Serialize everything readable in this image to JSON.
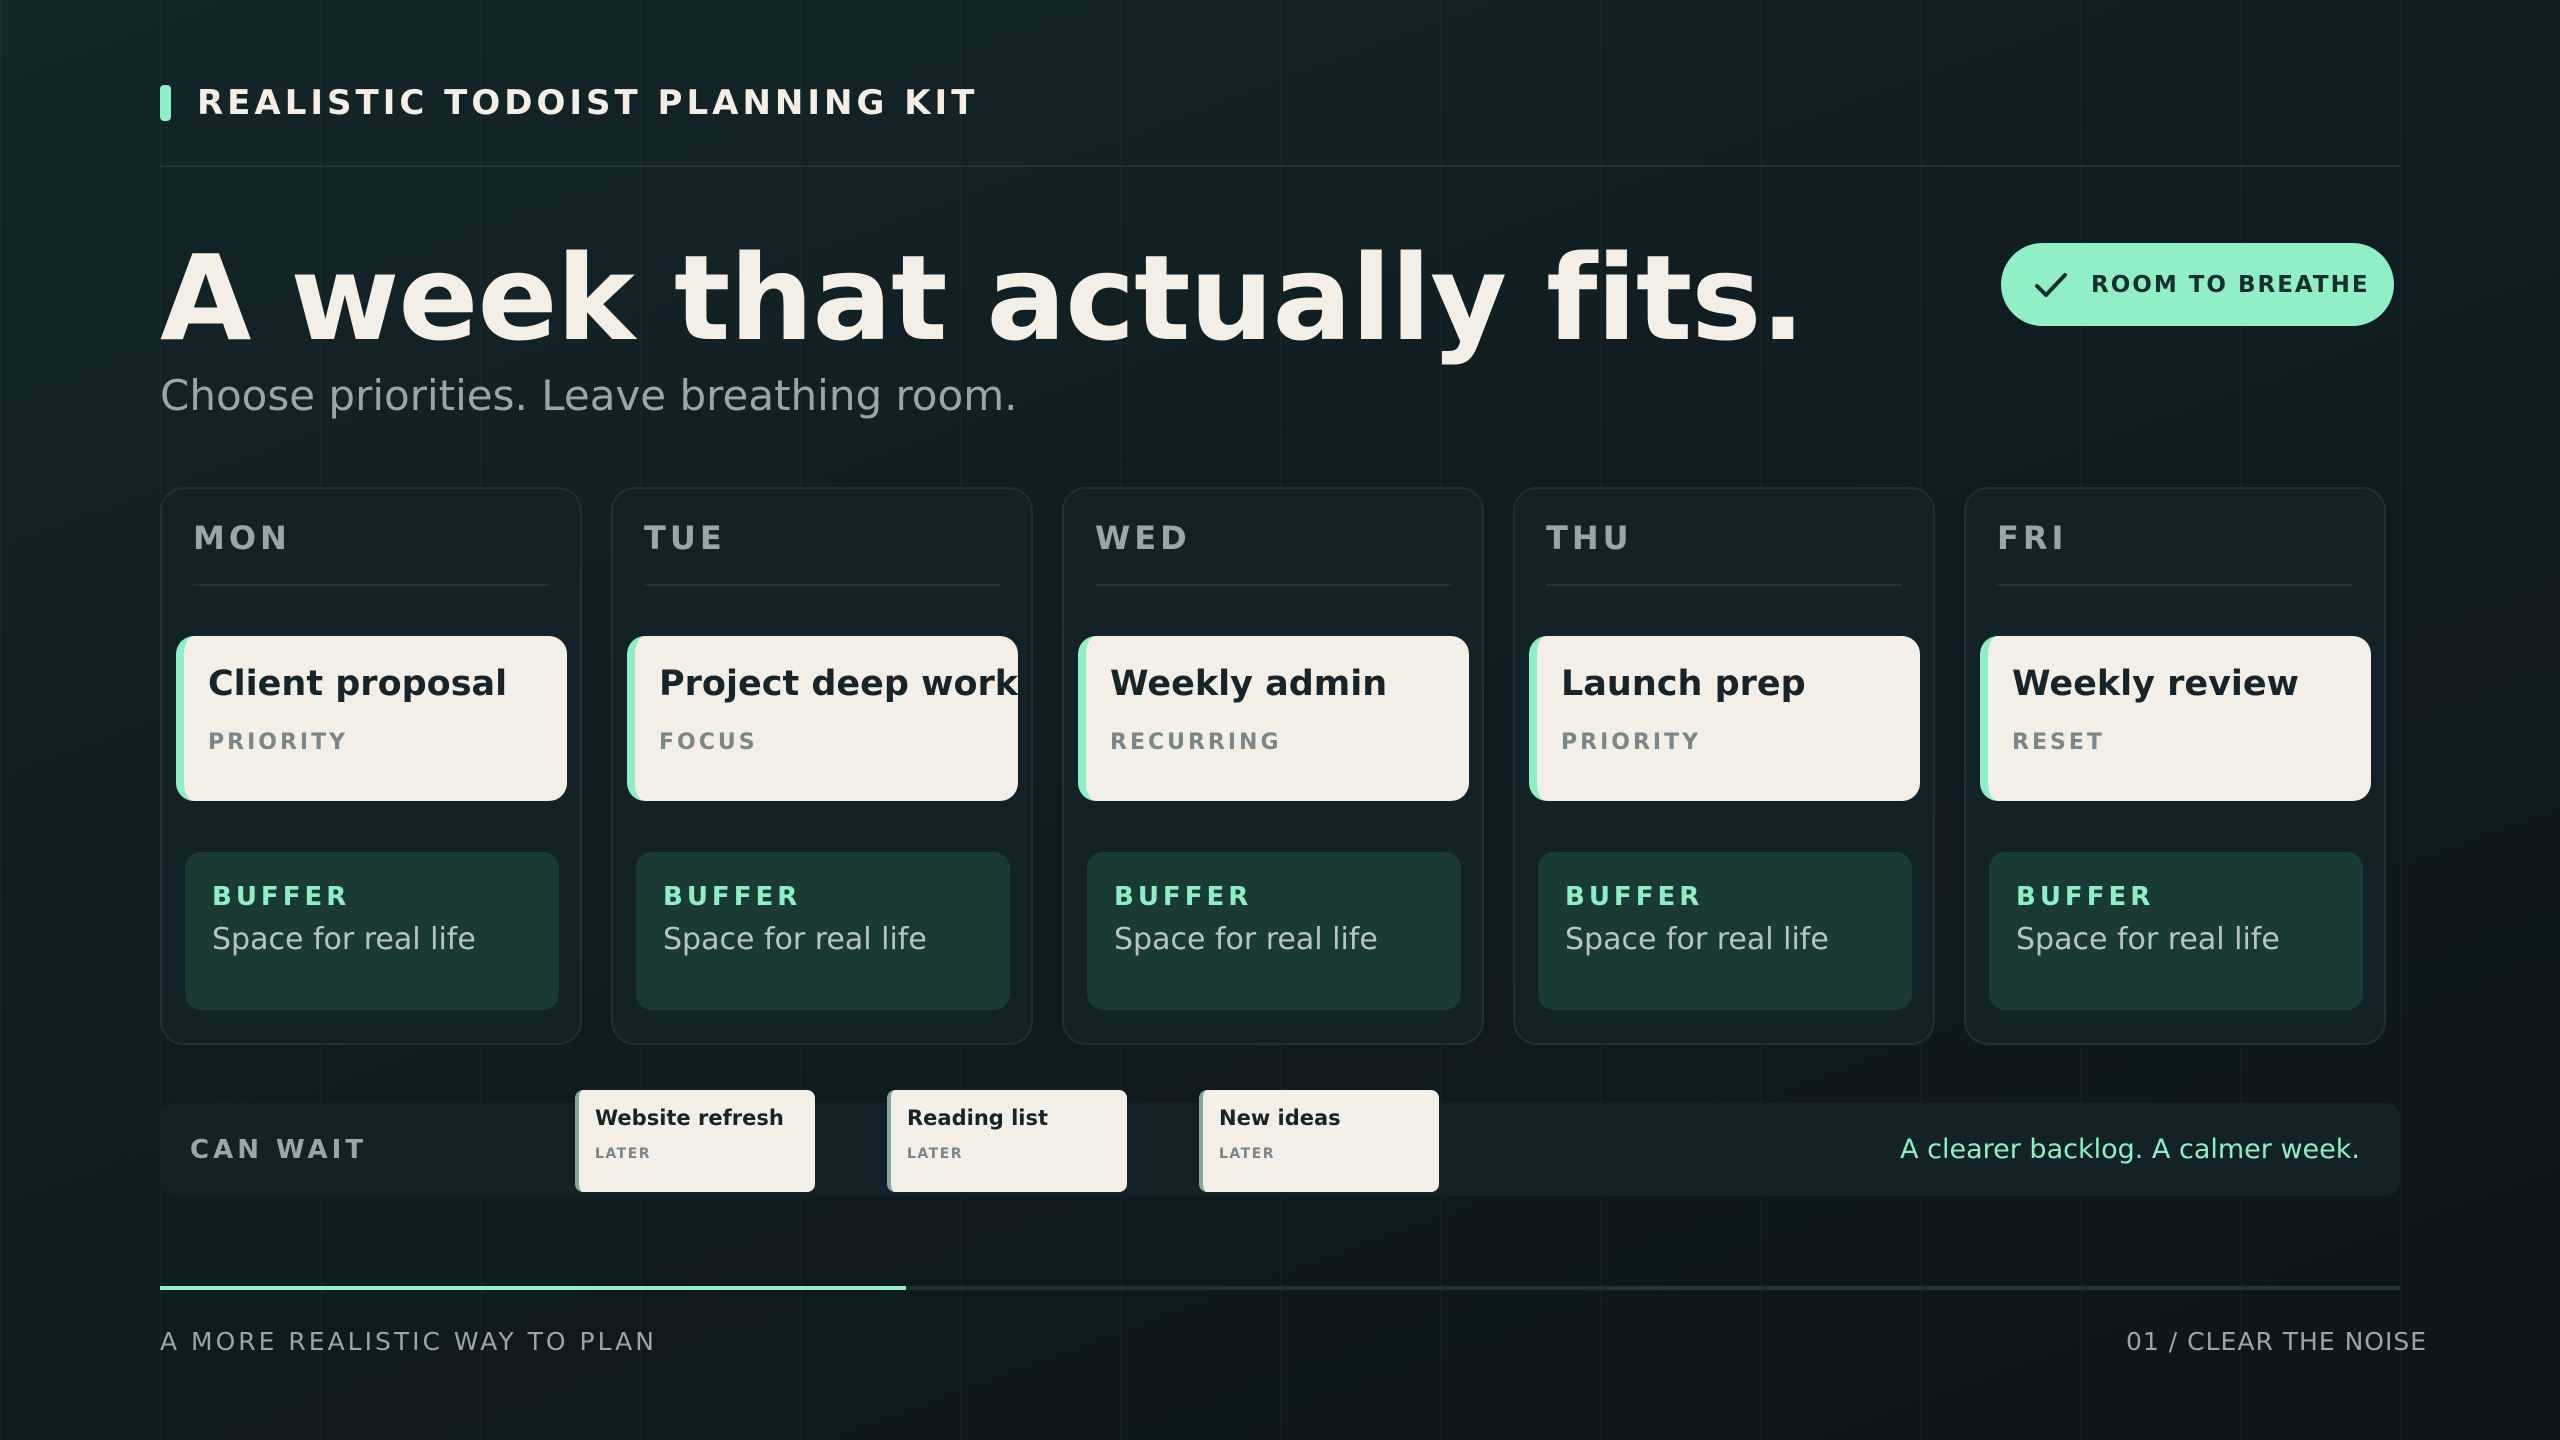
{
  "header": {
    "brand": "REALISTIC TODOIST PLANNING KIT"
  },
  "hero": {
    "title": "A week that actually fits.",
    "subtitle": "Choose priorities. Leave breathing room.",
    "badge": {
      "label": "ROOM TO BREATHE",
      "icon": "check-icon"
    }
  },
  "days": [
    {
      "day": "MON",
      "task": "Client proposal",
      "tag": "PRIORITY",
      "buffer_label": "BUFFER",
      "buffer_text": "Space for real life"
    },
    {
      "day": "TUE",
      "task": "Project deep work",
      "tag": "FOCUS",
      "buffer_label": "BUFFER",
      "buffer_text": "Space for real life"
    },
    {
      "day": "WED",
      "task": "Weekly admin",
      "tag": "RECURRING",
      "buffer_label": "BUFFER",
      "buffer_text": "Space for real life"
    },
    {
      "day": "THU",
      "task": "Launch prep",
      "tag": "PRIORITY",
      "buffer_label": "BUFFER",
      "buffer_text": "Space for real life"
    },
    {
      "day": "FRI",
      "task": "Weekly review",
      "tag": "RESET",
      "buffer_label": "BUFFER",
      "buffer_text": "Space for real life"
    }
  ],
  "can_wait": {
    "label": "CAN WAIT",
    "items": [
      {
        "title": "Website refresh",
        "tag": "LATER"
      },
      {
        "title": "Reading list",
        "tag": "LATER"
      },
      {
        "title": "New ideas",
        "tag": "LATER"
      }
    ],
    "note": "A clearer backlog. A calmer week."
  },
  "progress": {
    "fraction": 0.333
  },
  "footer": {
    "left": "A MORE REALISTIC WAY TO PLAN",
    "right": "01 / CLEAR THE NOISE"
  },
  "colors": {
    "accent": "#8eefc7",
    "background": "#0f1d22",
    "card": "#f3efe6",
    "buffer": "#1a3a36"
  }
}
